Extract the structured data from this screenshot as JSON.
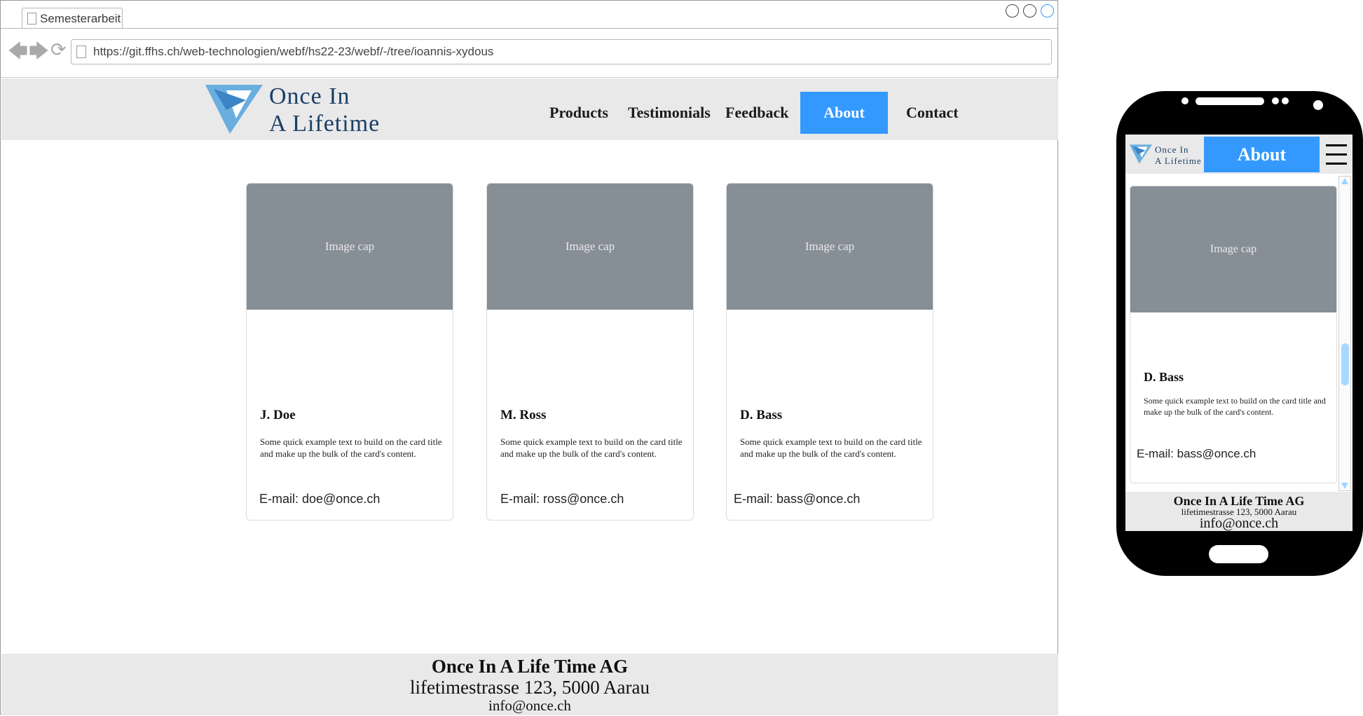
{
  "browser": {
    "tab_title": "Semesterarbeit",
    "url": "https://git.ffhs.ch/web-technologien/webf/hs22-23/webf/-/tree/ioannis-xydous",
    "back_glyph": "🡄",
    "forward_glyph": "🡆",
    "reload_glyph": "⟳"
  },
  "site": {
    "logo": {
      "line1": "Once In",
      "line2": "A Lifetime"
    },
    "nav": {
      "products": "Products",
      "testimonials": "Testimonials",
      "feedback": "Feedback",
      "about": "About",
      "contact": "Contact"
    },
    "accent_color": "#3399ff",
    "logo_color": "#1a3f66"
  },
  "cards": [
    {
      "image_cap": "Image cap",
      "name": "J. Doe",
      "text": "Some quick example text to build on the card title and make up the bulk of the card's content.",
      "email": "E-mail: doe@once.ch"
    },
    {
      "image_cap": "Image cap",
      "name": "M. Ross",
      "text": "Some quick example text to build on the card title and make up the bulk of the card's content.",
      "email": "E-mail: ross@once.ch"
    },
    {
      "image_cap": "Image cap",
      "name": "D. Bass",
      "text": "Some quick example text to build on the card title and make up the bulk of the card's content.",
      "email": "E-mail: bass@once.ch"
    }
  ],
  "footer": {
    "company": "Once In A Life Time AG",
    "address": "lifetimestrasse 123, 5000 Aarau",
    "email": "info@once.ch"
  },
  "mobile": {
    "nav_active": "About",
    "card": {
      "image_cap": "Image cap",
      "name": "D. Bass",
      "text": "Some quick example text to build on the card title and make up the bulk of the card's content.",
      "email": "E-mail: bass@once.ch"
    },
    "footer": {
      "company": "Once In A Life Time AG",
      "address": "lifetimestrasse 123, 5000 Aarau",
      "email": "info@once.ch"
    },
    "scroll_position": 0.62
  }
}
